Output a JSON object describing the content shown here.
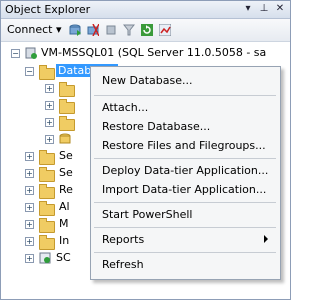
{
  "window": {
    "title": "Object Explorer",
    "pin_glyph": "▾",
    "autohide_glyph": "⊥",
    "close_glyph": "✕"
  },
  "toolbar": {
    "connect_label": "Connect ▾"
  },
  "tree": {
    "server": {
      "toggle": "−",
      "label": "VM-MSSQL01 (SQL Server 11.0.5058 - sa"
    },
    "databases": {
      "toggle": "−",
      "label": "Databases"
    },
    "collapsed_items": [
      {
        "toggle": "+",
        "label": "Se"
      },
      {
        "toggle": "+",
        "label": "Se"
      },
      {
        "toggle": "+",
        "label": "Re"
      },
      {
        "toggle": "+",
        "label": "Al"
      },
      {
        "toggle": "+",
        "label": "M"
      },
      {
        "toggle": "+",
        "label": "In"
      },
      {
        "toggle": "+",
        "label": "SC"
      }
    ],
    "db_children_toggles": [
      "+",
      "+",
      "+",
      "+"
    ]
  },
  "context_menu": {
    "items": [
      {
        "label": "New Database..."
      },
      {
        "label": "Attach..."
      },
      {
        "label": "Restore Database..."
      },
      {
        "label": "Restore Files and Filegroups..."
      },
      {
        "label": "Deploy Data-tier Application..."
      },
      {
        "label": "Import Data-tier Application..."
      },
      {
        "label": "Start PowerShell"
      },
      {
        "label": "Reports"
      },
      {
        "label": "Refresh"
      }
    ]
  }
}
